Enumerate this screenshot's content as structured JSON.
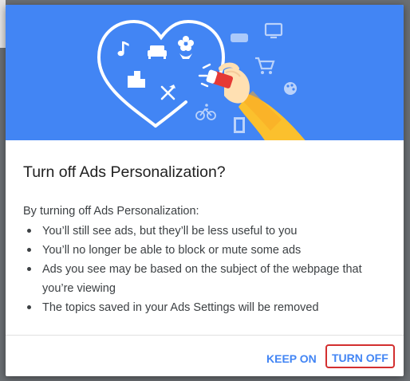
{
  "dialog": {
    "title": "Turn off Ads Personalization?",
    "intro": "By turning off Ads Personalization:",
    "bullets": [
      "You’ll still see ads, but they’ll be less useful to you",
      "You’ll no longer be able to block or mute some ads",
      "Ads you see may be based on the subject of the webpage that you’re viewing",
      "The topics saved in your Ads Settings will be removed"
    ],
    "buttons": {
      "keep_on": "KEEP ON",
      "turn_off": "TURN OFF"
    }
  },
  "colors": {
    "hero_background": "#4285f4",
    "button_text": "#4285f4",
    "highlight_border": "#d32f2f",
    "hand_sleeve": "#fbc02d",
    "eraser": "#e53935"
  },
  "illustration": {
    "icons_inside_heart": [
      "music-note-icon",
      "sofa-icon",
      "flower-icon",
      "buildings-icon",
      "utensils-icon"
    ],
    "icons_outside_heart": [
      "gamepad-icon",
      "tv-icon",
      "shopping-cart-icon",
      "palette-icon",
      "bicycle-icon",
      "film-icon"
    ]
  }
}
